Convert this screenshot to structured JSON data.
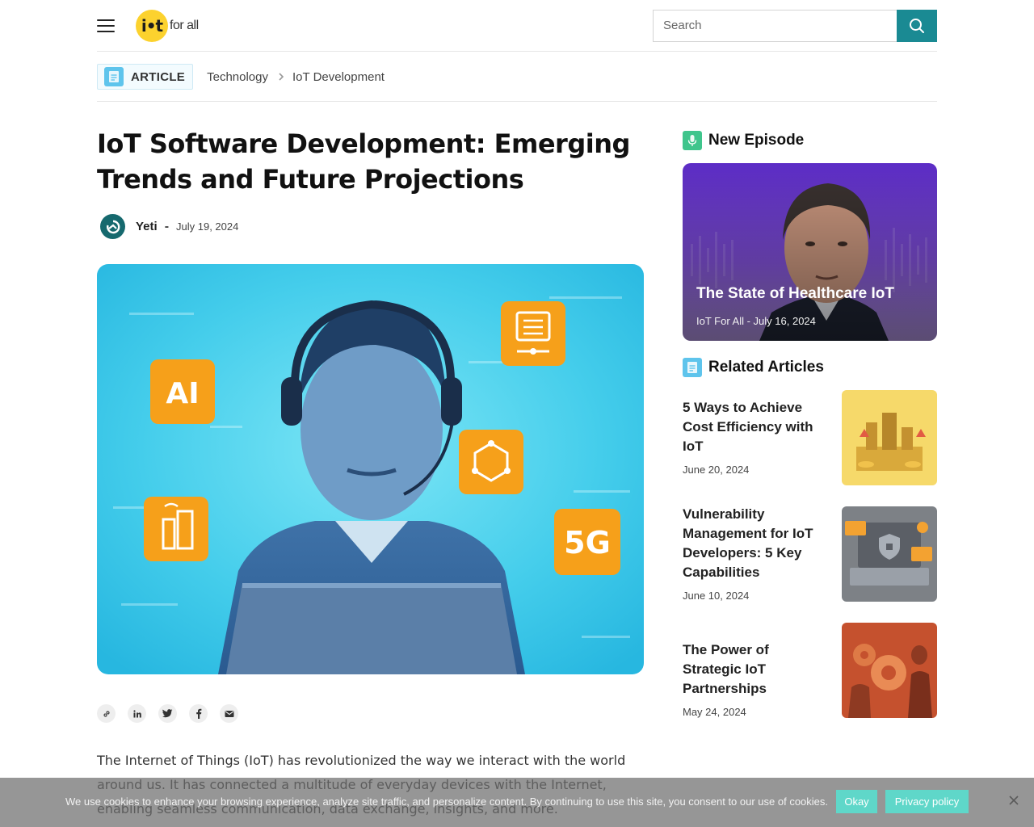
{
  "header": {
    "logo_mark": "i•t",
    "logo_text": "for all",
    "search_placeholder": "Search"
  },
  "breadcrumb": {
    "badge": "ARTICLE",
    "items": [
      "Technology",
      "IoT Development"
    ]
  },
  "article": {
    "title": "IoT Software Development: Emerging Trends and Future Projections",
    "author": "Yeti",
    "separator": "-",
    "date": "July 19, 2024",
    "hero_badges": [
      "AI",
      "5G"
    ],
    "body": "The Internet of Things (IoT) has revolutionized the way we interact with the world around us. It has connected a multitude of everyday devices with the Internet, enabling seamless communication, data exchange, insights, and more."
  },
  "share": {
    "icons": [
      "link-icon",
      "linkedin-icon",
      "twitter-icon",
      "facebook-icon",
      "email-icon"
    ]
  },
  "sidebar": {
    "new_episode": {
      "heading": "New Episode",
      "title": "The State of Healthcare IoT",
      "meta": "IoT For All - July 16, 2024"
    },
    "related": {
      "heading": "Related Articles",
      "items": [
        {
          "title": "5 Ways to Achieve Cost Efficiency with IoT",
          "date": "June 20, 2024"
        },
        {
          "title": "Vulnerability Management for IoT Developers: 5 Key Capabilities",
          "date": "June 10, 2024"
        },
        {
          "title": "The Power of Strategic IoT Partnerships",
          "date": "May 24, 2024"
        }
      ]
    }
  },
  "cookie": {
    "text": "We use cookies to enhance your browsing experience, analyze site traffic, and personalize content. By continuing to use this site, you consent to our use of cookies.",
    "okay": "Okay",
    "privacy": "Privacy policy"
  },
  "colors": {
    "accent": "#1a8a93",
    "logo_yellow": "#fcd22e",
    "cookie_button": "#5fd7c9"
  }
}
